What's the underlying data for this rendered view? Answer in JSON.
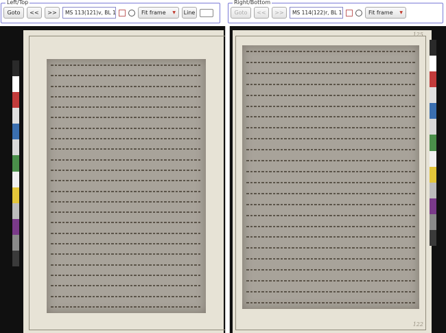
{
  "left_panel": {
    "legend": "Left/Top",
    "goto_label": "Goto",
    "prev_label": "<<",
    "next_label": ">>",
    "shelfmark_value": "MS 113(121)v, BL 124v",
    "fit_label": "Fit frame",
    "line_label": "Line"
  },
  "right_panel": {
    "legend": "Right/Bottom",
    "goto_label": "Goto",
    "prev_label": "<<",
    "next_label": ">>",
    "shelfmark_value": "MS 114(122)r, BL 125r",
    "fit_label": "Fit frame"
  },
  "right_viewer": {
    "folio_top": "125",
    "folio_bottom": "122"
  },
  "colors": {
    "accent_border": "#7a7ad6",
    "parchment": "#a8a39a",
    "mat": "#e7e3d6",
    "colorbar": [
      "#2a2a2a",
      "#ffffff",
      "#c23b3b",
      "#e0e0e0",
      "#3a6fb0",
      "#d9d9d9",
      "#4a8f4a",
      "#f0f0f0",
      "#e3c63a",
      "#bcbcbc",
      "#7a3a8a",
      "#8a8a8a",
      "#3a3a3a"
    ]
  }
}
